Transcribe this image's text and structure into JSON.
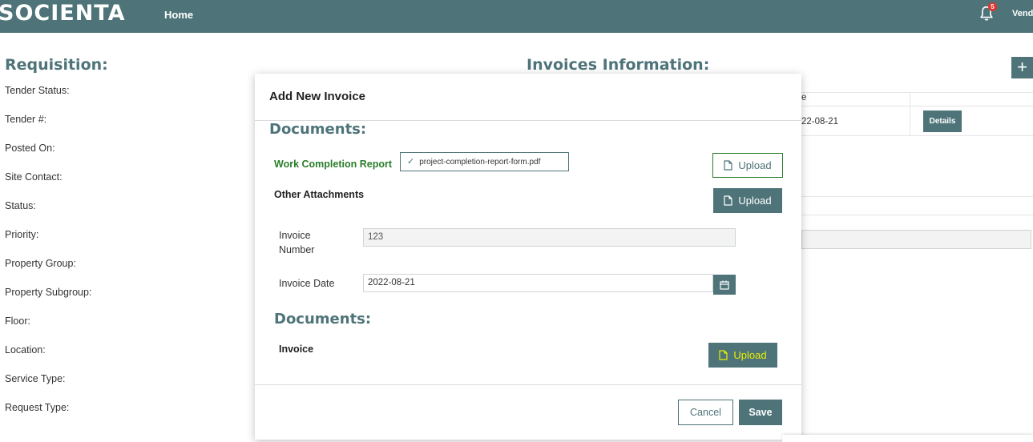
{
  "header": {
    "logo": "SOCIENTA",
    "nav_home": "Home",
    "notification_count": "5",
    "user_name": "Vendor",
    "icons": [
      "bell-icon"
    ]
  },
  "requisition": {
    "title": "Requisition:",
    "fields": [
      "Tender Status:",
      "Tender #:",
      "Posted On:",
      "Site Contact:",
      "Status:",
      "Priority:",
      "Property Group:",
      "Property Subgroup:",
      "Floor:",
      "Location:",
      "Service Type:",
      "Request Type:"
    ]
  },
  "invoices_info": {
    "title": "Invoices Information:",
    "add_button": "+",
    "column_fragment": "e",
    "row_date_fragment": "22-08-21",
    "details_button": "Details"
  },
  "modal": {
    "title": "Add New Invoice",
    "documents_title": "Documents:",
    "work_completion_label": "Work Completion Report",
    "work_completion_file": "project-completion-report-form.pdf",
    "other_attachments_label": "Other Attachments",
    "upload_label": "Upload",
    "invoice_number_label": "Invoice Number",
    "invoice_number_value": "123",
    "invoice_date_label": "Invoice Date",
    "invoice_date_value": "2022-08-21",
    "documents_title_2": "Documents:",
    "invoice_label": "Invoice",
    "cancel_label": "Cancel",
    "save_label": "Save",
    "icons": [
      "check-icon",
      "file-icon",
      "calendar-icon"
    ]
  },
  "colors": {
    "primary": "#4e7479",
    "success_text": "#2a7d2a",
    "highlight": "#e1f000",
    "badge": "#e0352b"
  }
}
